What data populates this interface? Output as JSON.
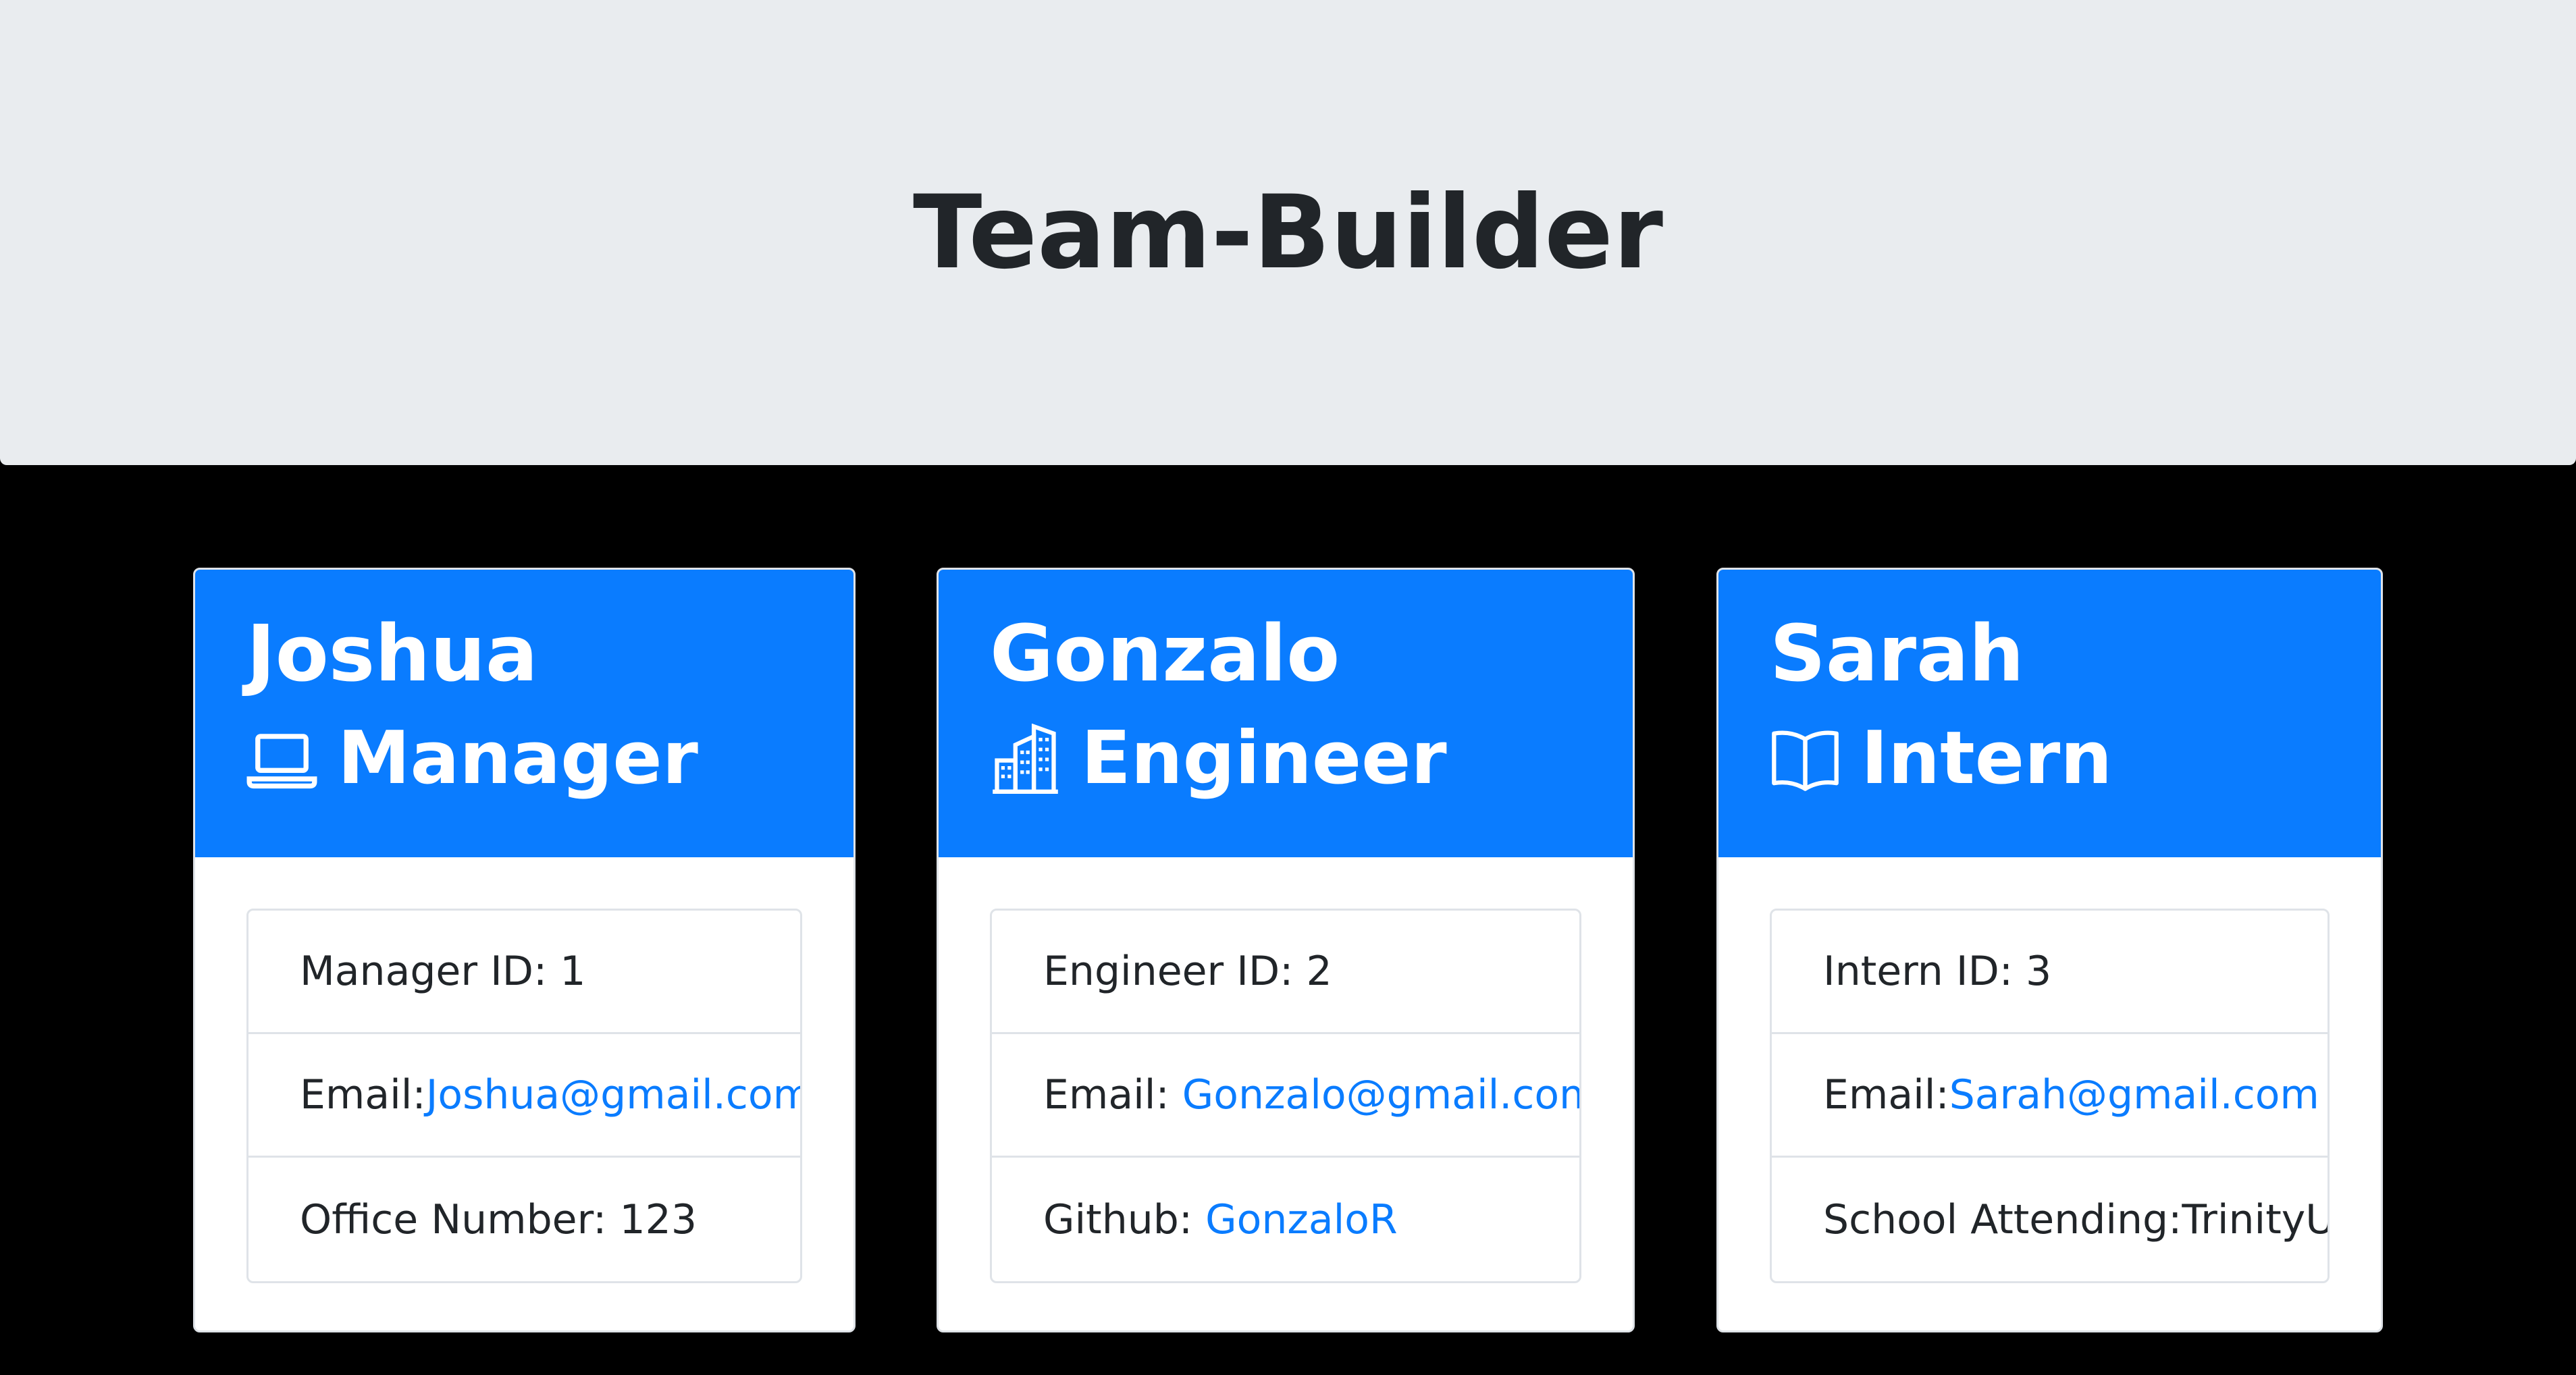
{
  "header": {
    "title": "Team-Builder"
  },
  "colors": {
    "accent": "#0a7cff",
    "jumbotron": "#e9ecef",
    "background": "#000000"
  },
  "cards": [
    {
      "name": "Joshua",
      "role": "Manager",
      "icon": "laptop-icon",
      "id_text": "Manager ID: 1",
      "email_label": "Email:",
      "email": "Joshua@gmail.com",
      "extra_label": "Office Number: 123",
      "extra_value": ""
    },
    {
      "name": "Gonzalo",
      "role": "Engineer",
      "icon": "building-icon",
      "id_text": "Engineer ID: 2",
      "email_label": "Email: ",
      "email": "Gonzalo@gmail.com",
      "extra_label": "Github: ",
      "extra_value": "GonzaloR"
    },
    {
      "name": "Sarah",
      "role": "Intern",
      "icon": "book-icon",
      "id_text": "Intern ID: 3",
      "email_label": "Email:",
      "email": "Sarah@gmail.com",
      "extra_label": "School Attending:TrinityU",
      "extra_value": ""
    }
  ]
}
